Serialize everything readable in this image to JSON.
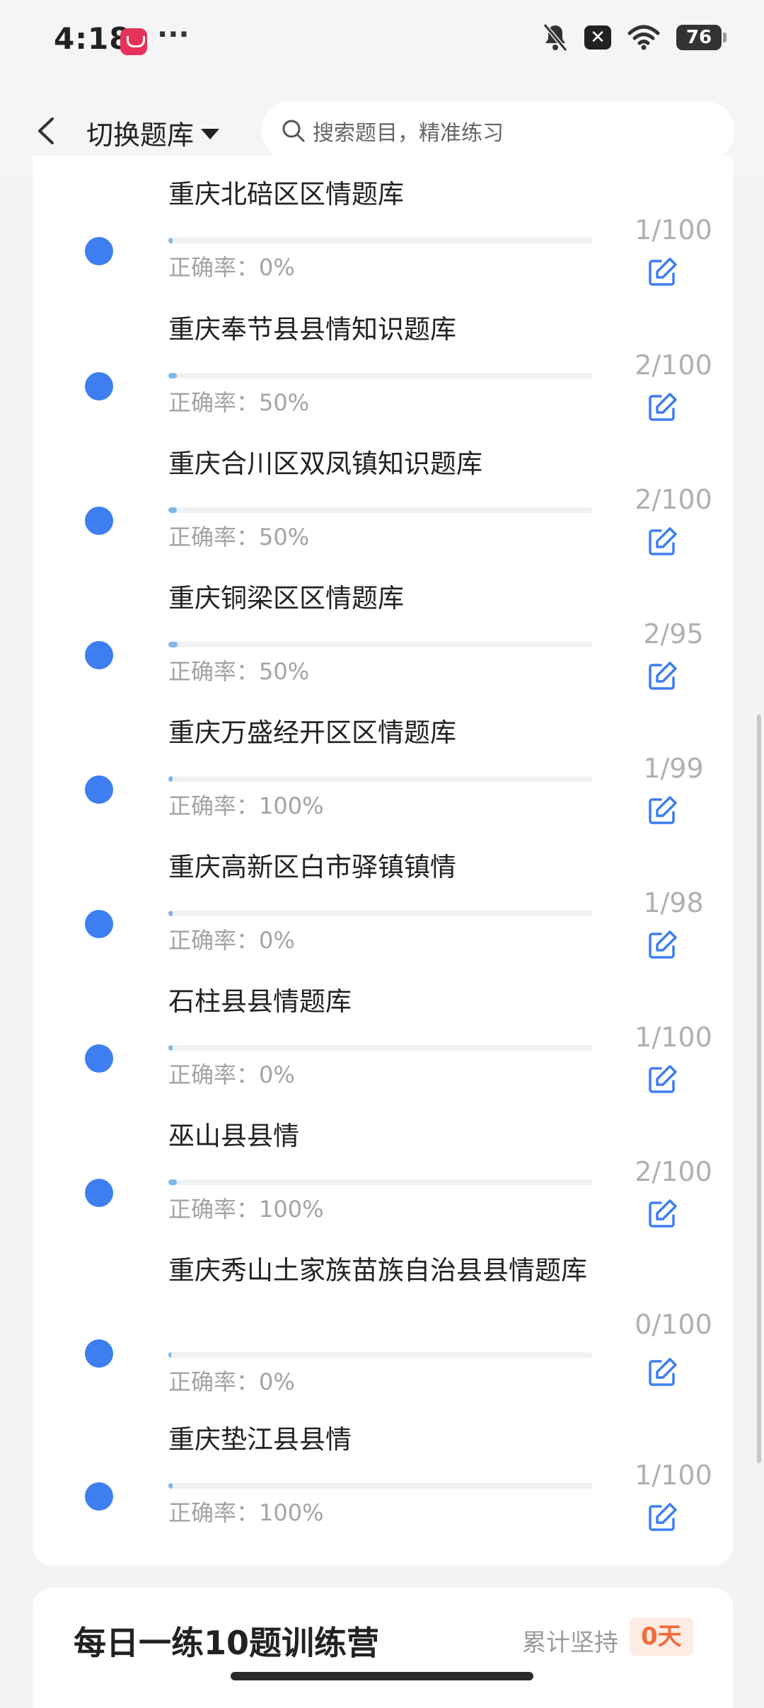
{
  "status": {
    "time": "4:18",
    "more": "···",
    "battery": "76"
  },
  "header": {
    "back_icon": "back-arrow",
    "switch_label": "切换题库",
    "search_placeholder": "搜索题目，精准练习"
  },
  "items": [
    {
      "name": "重庆北碚区区情题库",
      "accuracy": "正确率：0%",
      "count": "1/100",
      "progress": 0.01
    },
    {
      "name": "重庆奉节县县情知识题库",
      "accuracy": "正确率：50%",
      "count": "2/100",
      "progress": 0.02
    },
    {
      "name": "重庆合川区双凤镇知识题库",
      "accuracy": "正确率：50%",
      "count": "2/100",
      "progress": 0.02
    },
    {
      "name": "重庆铜梁区区情题库",
      "accuracy": "正确率：50%",
      "count": "2/95",
      "progress": 0.021
    },
    {
      "name": "重庆万盛经开区区情题库",
      "accuracy": "正确率：100%",
      "count": "1/99",
      "progress": 0.01
    },
    {
      "name": "重庆高新区白市驿镇镇情",
      "accuracy": "正确率：0%",
      "count": "1/98",
      "progress": 0.01
    },
    {
      "name": "石柱县县情题库",
      "accuracy": "正确率：0%",
      "count": "1/100",
      "progress": 0.01
    },
    {
      "name": "巫山县县情",
      "accuracy": "正确率：100%",
      "count": "2/100",
      "progress": 0.02
    },
    {
      "name": "重庆秀山土家族苗族自治县县情题库",
      "accuracy": "正确率：0%",
      "count": "0/100",
      "progress": 0
    },
    {
      "name": "重庆垫江县县情",
      "accuracy": "正确率：100%",
      "count": "1/100",
      "progress": 0.01
    }
  ],
  "daily": {
    "title": "每日一练10题训练营",
    "streak_label": "累计坚持",
    "streak_value": "0天"
  },
  "colors": {
    "accent": "#3d7ef0",
    "progress": "#7fb7e6",
    "streak": "#f26b3a"
  }
}
